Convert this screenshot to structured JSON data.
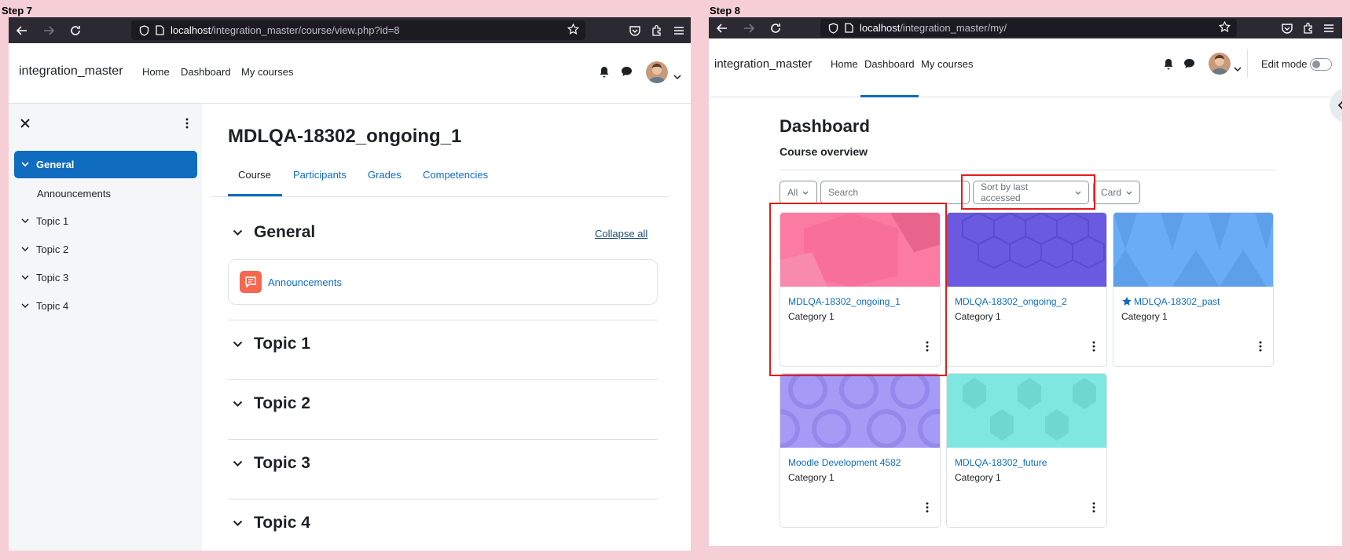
{
  "step7": {
    "label": "Step 7",
    "url_host": "localhost",
    "url_path": "/integration_master/course/view.php?id=8",
    "brand": "integration_master",
    "nav": [
      "Home",
      "Dashboard",
      "My courses"
    ],
    "drawer": {
      "general": "General",
      "announcements": "Announcements",
      "topics": [
        "Topic 1",
        "Topic 2",
        "Topic 3",
        "Topic 4"
      ]
    },
    "course_title": "MDLQA-18302_ongoing_1",
    "tabs": [
      "Course",
      "Participants",
      "Grades",
      "Competencies"
    ],
    "collapse_all": "Collapse all",
    "sections": {
      "general": "General",
      "announcements": "Announcements",
      "topics": [
        "Topic 1",
        "Topic 2",
        "Topic 3",
        "Topic 4"
      ]
    }
  },
  "step8": {
    "label": "Step 8",
    "url_host": "localhost",
    "url_path": "/integration_master/my/",
    "brand": "integration_master",
    "nav": [
      "Home",
      "Dashboard",
      "My courses"
    ],
    "edit_mode": "Edit mode",
    "title": "Dashboard",
    "subtitle": "Course overview",
    "filter_all": "All",
    "search_placeholder": "Search",
    "sort": "Sort by last accessed",
    "view": "Card",
    "cards": [
      {
        "name": "MDLQA-18302_ongoing_1",
        "category": "Category 1",
        "color": "#fb7ba2",
        "starred": false
      },
      {
        "name": "MDLQA-18302_ongoing_2",
        "category": "Category 1",
        "color": "#6a5ae0",
        "starred": false
      },
      {
        "name": "MDLQA-18302_past",
        "category": "Category 1",
        "color": "#6aacf5",
        "starred": true
      },
      {
        "name": "Moodle Development 4582",
        "category": "Category 1",
        "color": "#a69af7",
        "starred": false
      },
      {
        "name": "MDLQA-18302_future",
        "category": "Category 1",
        "color": "#80e6e0",
        "starred": false
      }
    ]
  },
  "colors": {
    "primary": "#0f6cbf",
    "highlight": "#e51b1b",
    "background": "#f6cfd6"
  }
}
